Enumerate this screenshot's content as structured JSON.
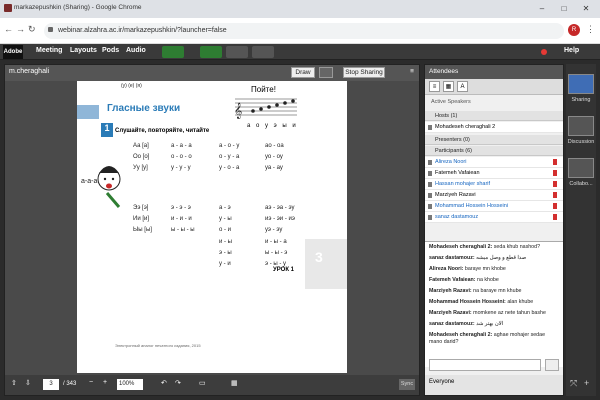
{
  "browser": {
    "title": "markazepushkin (Sharing) - Google Chrome",
    "url": "webinar.alzahra.ac.ir/markazepushkin/?launcher=false",
    "profile_initial": "R"
  },
  "menubar": {
    "logo": "Adobe",
    "items": [
      "Meeting",
      "Layouts",
      "Pods",
      "Audio"
    ],
    "help": "Help"
  },
  "share_pod": {
    "title": "m.cheraghali",
    "draw": "Draw",
    "stop_sharing": "Stop Sharing",
    "page_current": "3",
    "page_total": "/ 343",
    "zoom": "100%",
    "sync": "Sync"
  },
  "page": {
    "top_row": "(у)     (е)     (я)",
    "lesson_title": "Гласные звуки",
    "section_num": "1",
    "subhead": "Слушайте, повторяйте, читайте",
    "song_title": "Пойте!",
    "song_vowels": "а о у э ы и",
    "rows1": [
      [
        "Аа [а]",
        "а - а - а",
        "а - о - у",
        "ао - оа"
      ],
      [
        "Оо [о]",
        "о - о - о",
        "о - у - а",
        "уо - оу"
      ],
      [
        "Уу [у]",
        "у - у - у",
        "у - о - а",
        "уа - ау"
      ]
    ],
    "rows2": [
      [
        "Ээ [э]",
        "э - э - э",
        "а - э",
        "аэ - эа - эу"
      ],
      [
        "Ии [и]",
        "и - и - и",
        "у - ы",
        "иэ - эи - иэ"
      ],
      [
        "Ыы [ы]",
        "ы - ы - ы",
        "о - и",
        "уэ - эу"
      ]
    ],
    "rows3": [
      [
        "и - ы",
        "и - ы - а"
      ],
      [
        "э - ы",
        "ы - ы - э"
      ],
      [
        "у - и",
        "э - ы - у"
      ]
    ],
    "urok": "УРОК 1",
    "lesson_num": "3",
    "footer": "Электронный аналог печатного издания, 2015"
  },
  "attendees": {
    "title": "Attendees",
    "active_speakers": "Active Speakers",
    "hosts_label": "Hosts (1)",
    "hosts": [
      "Mohadeseh cheraghali 2"
    ],
    "presenters_label": "Presenters (0)",
    "participants_label": "Participants (6)",
    "participants": [
      {
        "name": "Alireza Noori",
        "link": true
      },
      {
        "name": "Fatemeh Vafaiean",
        "link": false
      },
      {
        "name": "Hassan mohajer sharif",
        "link": true
      },
      {
        "name": "Marziyeh Razavi",
        "link": false
      },
      {
        "name": "Mohammad Hossein Hosseini",
        "link": true
      },
      {
        "name": "sanaz dastamouz",
        "link": true
      }
    ]
  },
  "chat": {
    "messages": [
      {
        "who": "Mohadeseh cheraghali 2:",
        "text": "seda khub nashod?"
      },
      {
        "who": "sanaz dastamouz:",
        "text": "صدا قطع و وصل میشه"
      },
      {
        "who": "Alireza Noori:",
        "text": "baraye mn khobe"
      },
      {
        "who": "Fatemeh Vafaiean:",
        "text": "na khobe"
      },
      {
        "who": "Marziyeh Razavi:",
        "text": "na baraye mn khube"
      },
      {
        "who": "Mohammad Hossein Hosseini:",
        "text": "alan khube"
      },
      {
        "who": "Marziyeh Razavi:",
        "text": "momkene az nete tahun bashe"
      },
      {
        "who": "sanaz dastamouz:",
        "text": "الان بهتر شد"
      },
      {
        "who": "Mohadeseh cheraghali 2:",
        "text": "aghae mohajer sedae mano darid?"
      }
    ],
    "everyone": "Everyone"
  },
  "layouts": [
    "Sharing",
    "Discussion",
    "Collabo..."
  ]
}
